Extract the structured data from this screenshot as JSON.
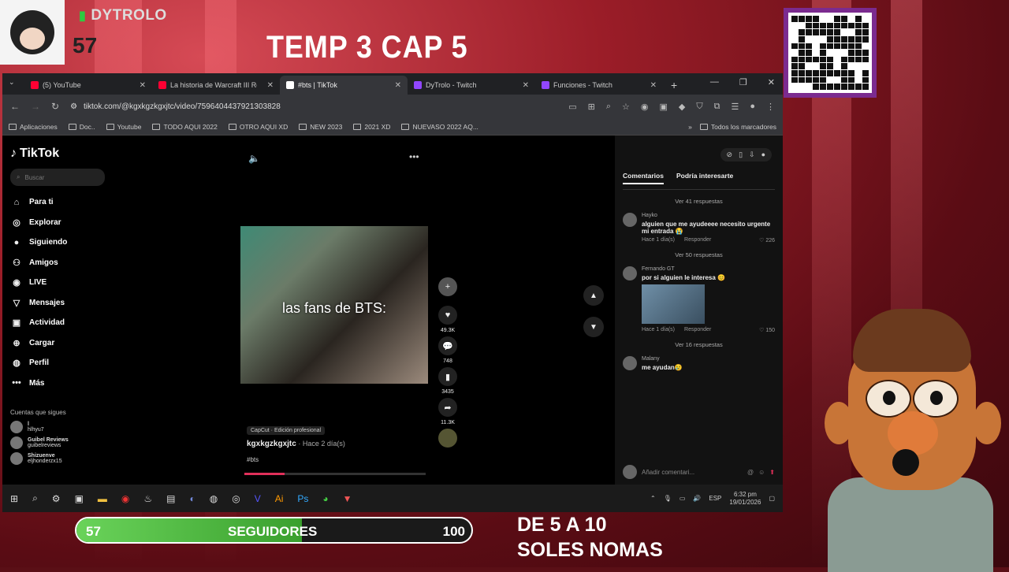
{
  "overlay": {
    "channel_name": "DYTROLO",
    "viewer_count": "57",
    "title": "TEMP 3 CAP 5",
    "qr_caption": "",
    "goal": {
      "current": "57",
      "label": "SEGUIDORES",
      "max": "100",
      "progress_fraction": 0.57
    },
    "promo_line1": "DE 5 A 10",
    "promo_line2": "SOLES NOMAS"
  },
  "browser": {
    "tabs": [
      {
        "label": "(5) YouTube",
        "color": "#ff0033"
      },
      {
        "label": "La historia de Warcraft III Re",
        "color": "#ff0033"
      },
      {
        "label": "#bts | TikTok",
        "color": "#ffffff",
        "active": true
      },
      {
        "label": "DyTrolo - Twitch",
        "color": "#9146ff"
      },
      {
        "label": "Funciones - Twitch",
        "color": "#9146ff"
      }
    ],
    "url": "tiktok.com/@kgxkgzkgxjtc/video/7596404437921303828",
    "bookmarks": [
      "Aplicaciones",
      "Doc..",
      "Youtube",
      "TODO AQUI 2022",
      "OTRO AQUI XD",
      "NEW 2023",
      "2021 XD",
      "NUEVASO 2022 AQ..."
    ],
    "all_bookmarks": "Todos los marcadores"
  },
  "tiktok": {
    "logo": "TikTok",
    "search_placeholder": "Buscar",
    "nav": [
      {
        "label": "Para ti",
        "icon": "home-icon"
      },
      {
        "label": "Explorar",
        "icon": "compass-icon"
      },
      {
        "label": "Siguiendo",
        "icon": "following-icon"
      },
      {
        "label": "Amigos",
        "icon": "friends-icon"
      },
      {
        "label": "LIVE",
        "icon": "live-icon"
      },
      {
        "label": "Mensajes",
        "icon": "message-icon"
      },
      {
        "label": "Actividad",
        "icon": "activity-icon"
      },
      {
        "label": "Cargar",
        "icon": "upload-icon"
      },
      {
        "label": "Perfil",
        "icon": "profile-icon"
      },
      {
        "label": "Más",
        "icon": "more-icon"
      }
    ],
    "following_header": "Cuentas que sigues",
    "following": [
      {
        "name": "l",
        "handle": "hlhyu7"
      },
      {
        "name": "Guibel Reviews",
        "handle": "guibelreviews"
      },
      {
        "name": "Shizuenve",
        "handle": "eljhonderzx15"
      }
    ],
    "video_caption": "las fans de BTS:",
    "likes": "49.3K",
    "comments_count": "748",
    "saves": "3435",
    "shares": "11.3K",
    "capcut": "CapCut · Edición profesional",
    "author": "kgxkgzkgxjtc",
    "posted": "· Hace 2 día(s)",
    "hashtag": "#bts",
    "progress_fraction": 0.22,
    "comments_tabs": [
      "Comentarios",
      "Podría interesarte"
    ],
    "comments": [
      {
        "name": "Hayko",
        "text": "alguien que me ayudeeee necesito urgente mi entrada 😭",
        "time": "Hace 1 día(s)",
        "reply": "Responder",
        "likes": "226",
        "replies_before": "Ver 41 respuestas",
        "replies_after": "Ver 50 respuestas"
      },
      {
        "name": "Fernando GT",
        "text": "por si alguien le interesa 😊",
        "time": "Hace 1 día(s)",
        "reply": "Responder",
        "likes": "150",
        "replies_after": "Ver 16 respuestas"
      },
      {
        "name": "Malany",
        "text": "me ayudan😢"
      }
    ],
    "comment_placeholder": "Añadir comentari..."
  },
  "taskbar": {
    "lang": "ESP",
    "time": "6:32 pm",
    "date": "19/01/2026"
  }
}
